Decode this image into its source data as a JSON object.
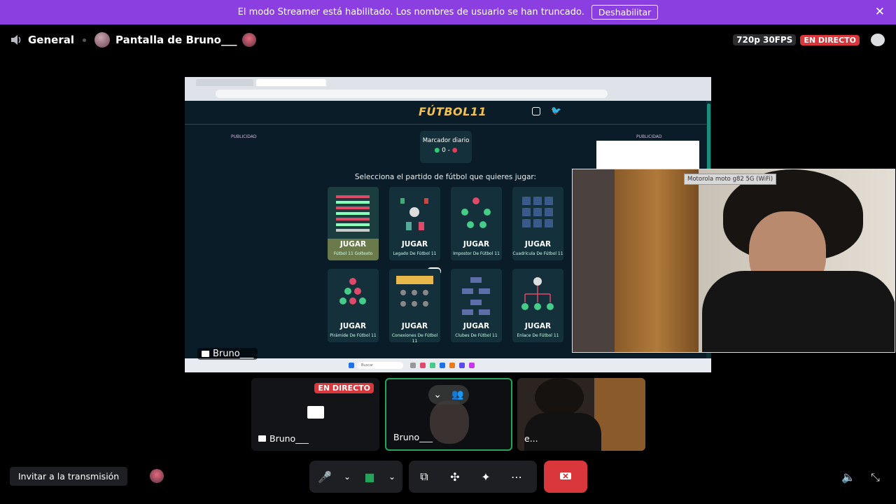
{
  "banner": {
    "message": "El modo Streamer está habilitado. Los nombres de usuario se han truncado.",
    "button": "Deshabilitar",
    "close": "✕"
  },
  "topbar": {
    "channel": "General",
    "screen_title": "Pantalla de Bruno___",
    "quality": "720p 30FPS",
    "live": "EN DIRECTO"
  },
  "stream": {
    "site_logo": "FÚTBOL11",
    "publicidad_left": "PUBLICIDAD",
    "publicidad_right": "PUBLICIDAD",
    "score_title": "Marcador diario",
    "score_value": "0 -",
    "select_prompt": "Selecciona el partido de fútbol que quieres jugar:",
    "cards": [
      {
        "play": "JUGAR",
        "name": "Fútbol 11 Goltexto"
      },
      {
        "play": "JUGAR",
        "name": "Legado De Fútbol 11"
      },
      {
        "play": "JUGAR",
        "name": "Impostor De Fútbol 11"
      },
      {
        "play": "JUGAR",
        "name": "Cuadrícula De Fútbol 11"
      },
      {
        "play": "JUGAR",
        "name": "Pirámide De Fútbol 11"
      },
      {
        "play": "JUGAR",
        "name": "Conexiones De Fútbol 11"
      },
      {
        "play": "JUGAR",
        "name": "Clubes De Fútbol 11"
      },
      {
        "play": "JUGAR",
        "name": "Enlace De Fútbol 11"
      }
    ],
    "taskbar_search": "Buscar",
    "name_tag": "Bruno___"
  },
  "webcam": {
    "device_tag": "Motorola moto g82 5G (WiFi)"
  },
  "tiles": [
    {
      "label": "Bruno___",
      "live": "EN DIRECTO"
    },
    {
      "label": "Bruno___"
    },
    {
      "label": "e..."
    }
  ],
  "bottom": {
    "invite": "Invitar a la transmisión"
  },
  "colors": {
    "banner": "#8b3fe0",
    "live": "#da373c",
    "speaking_border": "#23a55a",
    "logo": "#f2c14e"
  }
}
